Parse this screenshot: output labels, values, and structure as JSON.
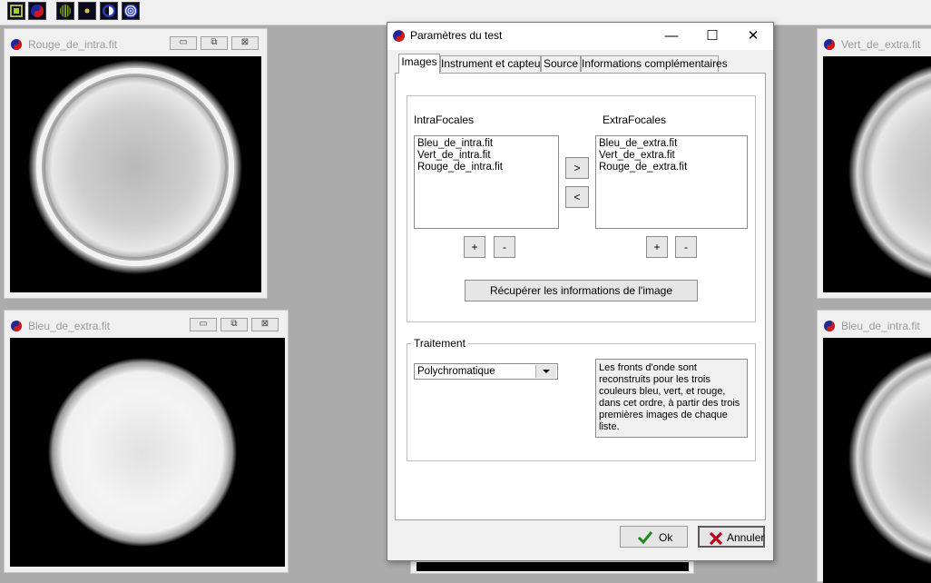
{
  "toolbar": {
    "buttons": [
      {
        "icon": "lens-tool-icon"
      },
      {
        "icon": "app-logo-icon"
      },
      {
        "icon": "grating-icon"
      },
      {
        "icon": "star-dot-icon"
      },
      {
        "icon": "eclipse-icon"
      },
      {
        "icon": "target-icon"
      }
    ]
  },
  "windows": {
    "rouge_intra": {
      "title": "Rouge_de_intra.fit"
    },
    "bleu_extra": {
      "title": "Bleu_de_extra.fit"
    },
    "vert_extra": {
      "title": "Vert_de_extra.fit"
    },
    "bleu_intra": {
      "title": "Bleu_de_intra.fit"
    }
  },
  "dialog": {
    "title": "Paramètres du test",
    "window_buttons": {
      "minimize": "—",
      "maximize": "☐",
      "close": "✕"
    },
    "tabs": [
      {
        "label": "Images",
        "active": true
      },
      {
        "label": "Instrument et capteur",
        "active": false
      },
      {
        "label": "Source",
        "active": false
      },
      {
        "label": "Informations complémentaires",
        "active": false
      }
    ],
    "images": {
      "intra_label": "IntraFocales",
      "extra_label": "ExtraFocales",
      "intra_items": [
        "Bleu_de_intra.fit",
        "Vert_de_intra.fit",
        "Rouge_de_intra.fit"
      ],
      "extra_items": [
        "Bleu_de_extra.fit",
        "Vert_de_extra.fit",
        "Rouge_de_extra.fit"
      ],
      "move_right": ">",
      "move_left": "<",
      "add": "+",
      "remove": "-",
      "retrieve_button": "Récupérer les informations de l'image"
    },
    "traitement": {
      "title": "Traitement",
      "selected": "Polychromatique",
      "info": "Les fronts d'onde sont reconstruits pour les trois couleurs bleu, vert, et rouge, dans cet ordre, à partir des trois premières images de chaque liste."
    },
    "buttons": {
      "ok": "Ok",
      "cancel": "Annuler"
    }
  },
  "colors": {
    "ok_check": "#1e8c1e",
    "cancel_x": "#c0001a",
    "app_icon_blue": "#1a2a9a",
    "app_icon_red": "#d01818"
  }
}
